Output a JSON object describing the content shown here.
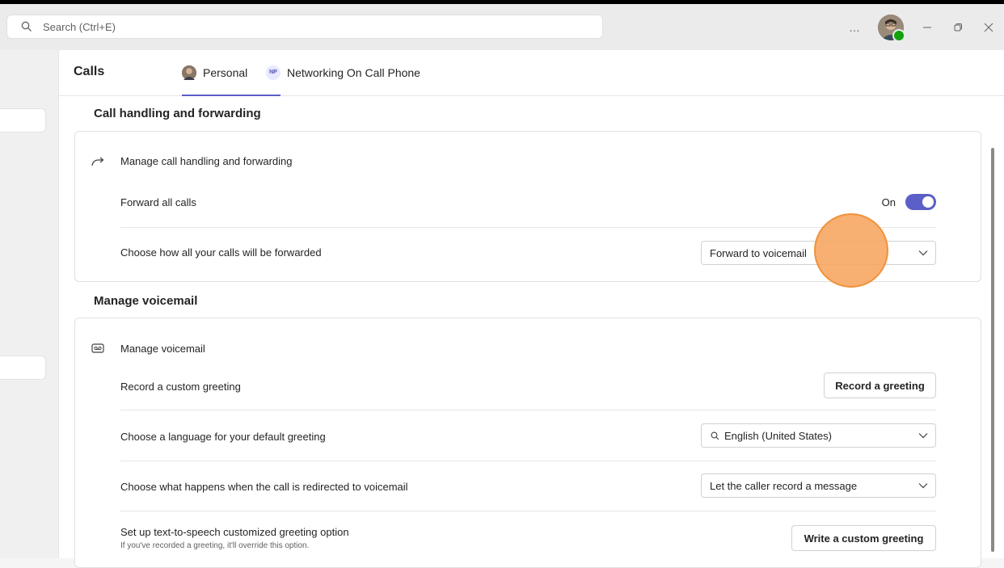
{
  "topbar": {
    "search_placeholder": "Search (Ctrl+E)",
    "more_label": "…"
  },
  "header": {
    "title": "Calls",
    "tabs": [
      {
        "label": "Personal",
        "selected": true
      },
      {
        "label": "Networking On Call Phone",
        "initials": "NP",
        "selected": false
      }
    ]
  },
  "call_handling": {
    "section_title": "Call handling and forwarding",
    "card_header": "Manage call handling and forwarding",
    "forward_all_label": "Forward all calls",
    "forward_toggle_state": "On",
    "forward_how_label": "Choose how all your calls will be forwarded",
    "forward_how_value": "Forward to voicemail"
  },
  "voicemail": {
    "section_title": "Manage voicemail",
    "card_header": "Manage voicemail",
    "record_label": "Record a custom greeting",
    "record_button": "Record a greeting",
    "language_label": "Choose a language for your default greeting",
    "language_value": "English (United States)",
    "redirect_label": "Choose what happens when the call is redirected to voicemail",
    "redirect_value": "Let the caller record a message",
    "tts_label": "Set up text-to-speech customized greeting option",
    "tts_sublabel": "If you've recorded a greeting, it'll override this option.",
    "tts_button": "Write a custom greeting"
  },
  "colors": {
    "accent": "#5b5fc7",
    "click_marker": "#f7a45e"
  }
}
